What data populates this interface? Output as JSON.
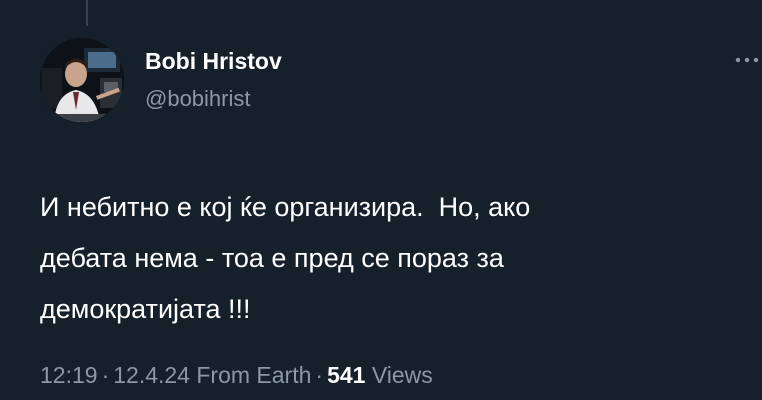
{
  "tweet": {
    "author": {
      "display_name": "Bobi Hristov",
      "handle": "@bobihrist",
      "avatar_icon": "profile-photo"
    },
    "more_icon": "ellipsis-icon",
    "text": "И небитно е кој ќе организира.  Но, ако\nдебата нема - тоа е пред се пораз за\nдемократијата !!!",
    "meta": {
      "time": "12:19",
      "separator": "·",
      "date": "12.4.24",
      "source": "From Earth",
      "views_count": "541",
      "views_label": "Views"
    }
  },
  "colors": {
    "background": "#15202b",
    "text_primary": "#ffffff",
    "text_secondary": "#8b98a5",
    "thread_line": "#38444d"
  }
}
